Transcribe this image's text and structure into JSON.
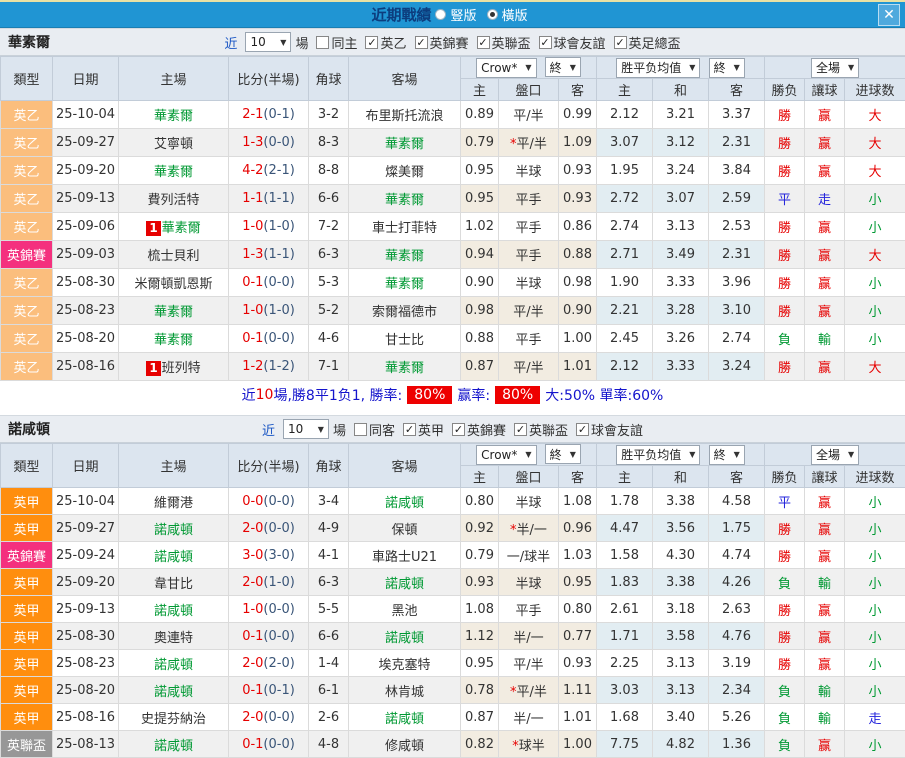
{
  "icons": {
    "dropdown_arrow": "▼",
    "close": "✕",
    "check": "✓",
    "star": "*"
  },
  "titlebar": {
    "title": "近期戰績",
    "radio_vertical": "豎版",
    "radio_horizontal": "橫版"
  },
  "headers": {
    "type": "類型",
    "date": "日期",
    "home": "主場",
    "score": "比分(半場)",
    "corner": "角球",
    "away": "客場",
    "dd_crow": "Crow*",
    "dd_final": "終",
    "dd_avg": "胜平负均值",
    "dd_full": "全場",
    "sub_home": "主",
    "sub_handicap": "盤口",
    "sub_away": "客",
    "sub_avg_home": "主",
    "sub_avg_draw": "和",
    "sub_avg_away": "客",
    "sub_result": "勝负",
    "sub_give": "讓球",
    "sub_goals": "进球数"
  },
  "sections": [
    {
      "team": "華素爾",
      "near_label": "近",
      "games_value": "10",
      "games_label": "場",
      "same_label": "同主",
      "leagues": [
        "英乙",
        "英錦賽",
        "英聯盃",
        "球會友誼",
        "英足總盃"
      ],
      "rows": [
        {
          "tk": "l2",
          "type": "英乙",
          "date": "25-10-04",
          "hb": "",
          "home": "華素爾",
          "hg": true,
          "score": "2-1",
          "half": "(0-1)",
          "corner": "3-2",
          "away": "布里斯托流浪",
          "ag": false,
          "o1": "0.89",
          "star": false,
          "hcp": "平/半",
          "o2": "0.99",
          "a1": "2.12",
          "a2": "3.21",
          "a3": "3.37",
          "r1": "勝",
          "c1": "r",
          "r2": "赢",
          "c2": "r",
          "r3": "大",
          "c3": "r"
        },
        {
          "tk": "l2",
          "type": "英乙",
          "date": "25-09-27",
          "hb": "",
          "home": "艾寧頓",
          "hg": false,
          "score": "1-3",
          "half": "(0-0)",
          "corner": "8-3",
          "away": "華素爾",
          "ag": true,
          "o1": "0.79",
          "star": true,
          "hcp": "平/半",
          "o2": "1.09",
          "a1": "3.07",
          "a2": "3.12",
          "a3": "2.31",
          "r1": "勝",
          "c1": "r",
          "r2": "赢",
          "c2": "r",
          "r3": "大",
          "c3": "r"
        },
        {
          "tk": "l2",
          "type": "英乙",
          "date": "25-09-20",
          "hb": "",
          "home": "華素爾",
          "hg": true,
          "score": "4-2",
          "half": "(2-1)",
          "corner": "8-8",
          "away": "燦美爾",
          "ag": false,
          "o1": "0.95",
          "star": false,
          "hcp": "半球",
          "o2": "0.93",
          "a1": "1.95",
          "a2": "3.24",
          "a3": "3.84",
          "r1": "勝",
          "c1": "r",
          "r2": "赢",
          "c2": "r",
          "r3": "大",
          "c3": "r"
        },
        {
          "tk": "l2",
          "type": "英乙",
          "date": "25-09-13",
          "hb": "",
          "home": "費列活特",
          "hg": false,
          "score": "1-1",
          "half": "(1-1)",
          "corner": "6-6",
          "away": "華素爾",
          "ag": true,
          "o1": "0.95",
          "star": false,
          "hcp": "平手",
          "o2": "0.93",
          "a1": "2.72",
          "a2": "3.07",
          "a3": "2.59",
          "r1": "平",
          "c1": "b",
          "r2": "走",
          "c2": "b",
          "r3": "小",
          "c3": "g"
        },
        {
          "tk": "l2",
          "type": "英乙",
          "date": "25-09-06",
          "hb": "1",
          "home": "華素爾",
          "hg": true,
          "score": "1-0",
          "half": "(1-0)",
          "corner": "7-2",
          "away": "車士打菲特",
          "ag": false,
          "o1": "1.02",
          "star": false,
          "hcp": "平手",
          "o2": "0.86",
          "a1": "2.74",
          "a2": "3.13",
          "a3": "2.53",
          "r1": "勝",
          "c1": "r",
          "r2": "赢",
          "c2": "r",
          "r3": "小",
          "c3": "g"
        },
        {
          "tk": "trophy",
          "type": "英錦賽",
          "date": "25-09-03",
          "hb": "",
          "home": "梳士貝利",
          "hg": false,
          "score": "1-3",
          "half": "(1-1)",
          "corner": "6-3",
          "away": "華素爾",
          "ag": true,
          "o1": "0.94",
          "star": false,
          "hcp": "平手",
          "o2": "0.88",
          "a1": "2.71",
          "a2": "3.49",
          "a3": "2.31",
          "r1": "勝",
          "c1": "r",
          "r2": "赢",
          "c2": "r",
          "r3": "大",
          "c3": "r"
        },
        {
          "tk": "l2",
          "type": "英乙",
          "date": "25-08-30",
          "hb": "",
          "home": "米爾頓凱恩斯",
          "hg": false,
          "score": "0-1",
          "half": "(0-0)",
          "corner": "5-3",
          "away": "華素爾",
          "ag": true,
          "o1": "0.90",
          "star": false,
          "hcp": "半球",
          "o2": "0.98",
          "a1": "1.90",
          "a2": "3.33",
          "a3": "3.96",
          "r1": "勝",
          "c1": "r",
          "r2": "赢",
          "c2": "r",
          "r3": "小",
          "c3": "g"
        },
        {
          "tk": "l2",
          "type": "英乙",
          "date": "25-08-23",
          "hb": "",
          "home": "華素爾",
          "hg": true,
          "score": "1-0",
          "half": "(1-0)",
          "corner": "5-2",
          "away": "索爾福德市",
          "ag": false,
          "o1": "0.98",
          "star": false,
          "hcp": "平/半",
          "o2": "0.90",
          "a1": "2.21",
          "a2": "3.28",
          "a3": "3.10",
          "r1": "勝",
          "c1": "r",
          "r2": "赢",
          "c2": "r",
          "r3": "小",
          "c3": "g"
        },
        {
          "tk": "l2",
          "type": "英乙",
          "date": "25-08-20",
          "hb": "",
          "home": "華素爾",
          "hg": true,
          "score": "0-1",
          "half": "(0-0)",
          "corner": "4-6",
          "away": "甘士比",
          "ag": false,
          "o1": "0.88",
          "star": false,
          "hcp": "平手",
          "o2": "1.00",
          "a1": "2.45",
          "a2": "3.26",
          "a3": "2.74",
          "r1": "負",
          "c1": "g",
          "r2": "輸",
          "c2": "g",
          "r3": "小",
          "c3": "g"
        },
        {
          "tk": "l2",
          "type": "英乙",
          "date": "25-08-16",
          "hb": "1",
          "home": "班列特",
          "hg": false,
          "score": "1-2",
          "half": "(1-2)",
          "corner": "7-1",
          "away": "華素爾",
          "ag": true,
          "o1": "0.87",
          "star": false,
          "hcp": "平/半",
          "o2": "1.01",
          "a1": "2.12",
          "a2": "3.33",
          "a3": "3.24",
          "r1": "勝",
          "c1": "r",
          "r2": "赢",
          "c2": "r",
          "r3": "大",
          "c3": "r"
        }
      ],
      "summary": {
        "p1": "近",
        "games": "10",
        "p2": "場,勝8平1负1, 勝率:",
        "win_rate": "80%",
        "p3": "赢率:",
        "handicap_rate": "80%",
        "p4": "大:50% 單率:60%"
      }
    },
    {
      "team": "諾咸頓",
      "near_label": "近",
      "games_value": "10",
      "games_label": "場",
      "same_label": "同客",
      "leagues": [
        "英甲",
        "英錦賽",
        "英聯盃",
        "球會友誼"
      ],
      "rows": [
        {
          "tk": "l1",
          "type": "英甲",
          "date": "25-10-04",
          "hb": "",
          "home": "維爾港",
          "hg": false,
          "score": "0-0",
          "half": "(0-0)",
          "corner": "3-4",
          "away": "諾咸頓",
          "ag": true,
          "o1": "0.80",
          "star": false,
          "hcp": "半球",
          "o2": "1.08",
          "a1": "1.78",
          "a2": "3.38",
          "a3": "4.58",
          "r1": "平",
          "c1": "b",
          "r2": "赢",
          "c2": "r",
          "r3": "小",
          "c3": "g"
        },
        {
          "tk": "l1",
          "type": "英甲",
          "date": "25-09-27",
          "hb": "",
          "home": "諾咸頓",
          "hg": true,
          "score": "2-0",
          "half": "(0-0)",
          "corner": "4-9",
          "away": "保頓",
          "ag": false,
          "o1": "0.92",
          "star": true,
          "hcp": "半/一",
          "o2": "0.96",
          "a1": "4.47",
          "a2": "3.56",
          "a3": "1.75",
          "r1": "勝",
          "c1": "r",
          "r2": "赢",
          "c2": "r",
          "r3": "小",
          "c3": "g"
        },
        {
          "tk": "trophy",
          "type": "英錦賽",
          "date": "25-09-24",
          "hb": "",
          "home": "諾咸頓",
          "hg": true,
          "score": "3-0",
          "half": "(3-0)",
          "corner": "4-1",
          "away": "車路士U21",
          "ag": false,
          "o1": "0.79",
          "star": false,
          "hcp": "一/球半",
          "o2": "1.03",
          "a1": "1.58",
          "a2": "4.30",
          "a3": "4.74",
          "r1": "勝",
          "c1": "r",
          "r2": "赢",
          "c2": "r",
          "r3": "小",
          "c3": "g"
        },
        {
          "tk": "l1",
          "type": "英甲",
          "date": "25-09-20",
          "hb": "",
          "home": "韋甘比",
          "hg": false,
          "score": "2-0",
          "half": "(1-0)",
          "corner": "6-3",
          "away": "諾咸頓",
          "ag": true,
          "o1": "0.93",
          "star": false,
          "hcp": "半球",
          "o2": "0.95",
          "a1": "1.83",
          "a2": "3.38",
          "a3": "4.26",
          "r1": "負",
          "c1": "g",
          "r2": "輸",
          "c2": "g",
          "r3": "小",
          "c3": "g"
        },
        {
          "tk": "l1",
          "type": "英甲",
          "date": "25-09-13",
          "hb": "",
          "home": "諾咸頓",
          "hg": true,
          "score": "1-0",
          "half": "(0-0)",
          "corner": "5-5",
          "away": "黑池",
          "ag": false,
          "o1": "1.08",
          "star": false,
          "hcp": "平手",
          "o2": "0.80",
          "a1": "2.61",
          "a2": "3.18",
          "a3": "2.63",
          "r1": "勝",
          "c1": "r",
          "r2": "赢",
          "c2": "r",
          "r3": "小",
          "c3": "g"
        },
        {
          "tk": "l1",
          "type": "英甲",
          "date": "25-08-30",
          "hb": "",
          "home": "奧連特",
          "hg": false,
          "score": "0-1",
          "half": "(0-0)",
          "corner": "6-6",
          "away": "諾咸頓",
          "ag": true,
          "o1": "1.12",
          "star": false,
          "hcp": "半/一",
          "o2": "0.77",
          "a1": "1.71",
          "a2": "3.58",
          "a3": "4.76",
          "r1": "勝",
          "c1": "r",
          "r2": "赢",
          "c2": "r",
          "r3": "小",
          "c3": "g"
        },
        {
          "tk": "l1",
          "type": "英甲",
          "date": "25-08-23",
          "hb": "",
          "home": "諾咸頓",
          "hg": true,
          "score": "2-0",
          "half": "(2-0)",
          "corner": "1-4",
          "away": "埃克塞特",
          "ag": false,
          "o1": "0.95",
          "star": false,
          "hcp": "平/半",
          "o2": "0.93",
          "a1": "2.25",
          "a2": "3.13",
          "a3": "3.19",
          "r1": "勝",
          "c1": "r",
          "r2": "赢",
          "c2": "r",
          "r3": "小",
          "c3": "g"
        },
        {
          "tk": "l1",
          "type": "英甲",
          "date": "25-08-20",
          "hb": "",
          "home": "諾咸頓",
          "hg": true,
          "score": "0-1",
          "half": "(0-1)",
          "corner": "6-1",
          "away": "林肯城",
          "ag": false,
          "o1": "0.78",
          "star": true,
          "hcp": "平/半",
          "o2": "1.11",
          "a1": "3.03",
          "a2": "3.13",
          "a3": "2.34",
          "r1": "負",
          "c1": "g",
          "r2": "輸",
          "c2": "g",
          "r3": "小",
          "c3": "g"
        },
        {
          "tk": "l1",
          "type": "英甲",
          "date": "25-08-16",
          "hb": "",
          "home": "史提芬納治",
          "hg": false,
          "score": "2-0",
          "half": "(0-0)",
          "corner": "2-6",
          "away": "諾咸頓",
          "ag": true,
          "o1": "0.87",
          "star": false,
          "hcp": "半/一",
          "o2": "1.01",
          "a1": "1.68",
          "a2": "3.40",
          "a3": "5.26",
          "r1": "負",
          "c1": "g",
          "r2": "輸",
          "c2": "g",
          "r3": "走",
          "c3": "b"
        },
        {
          "tk": "cup",
          "type": "英聯盃",
          "date": "25-08-13",
          "hb": "",
          "home": "諾咸頓",
          "hg": true,
          "score": "0-1",
          "half": "(0-0)",
          "corner": "4-8",
          "away": "修咸頓",
          "ag": false,
          "o1": "0.82",
          "star": true,
          "hcp": "球半",
          "o2": "1.00",
          "a1": "7.75",
          "a2": "4.82",
          "a3": "1.36",
          "r1": "負",
          "c1": "g",
          "r2": "赢",
          "c2": "r",
          "r3": "小",
          "c3": "g"
        }
      ]
    }
  ]
}
